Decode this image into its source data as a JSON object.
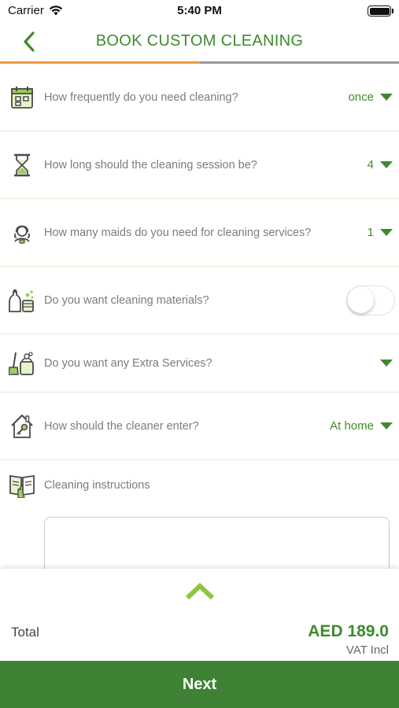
{
  "status_bar": {
    "carrier": "Carrier",
    "time": "5:40 PM"
  },
  "header": {
    "title": "BOOK CUSTOM CLEANING",
    "progress_fraction": 0.5
  },
  "questions": [
    {
      "icon": "calendar-icon",
      "text": "How frequently do you need cleaning?",
      "value": "once"
    },
    {
      "icon": "hourglass-icon",
      "text": "How long should the cleaning session be?",
      "value": "4"
    },
    {
      "icon": "maid-icon",
      "text": "How many maids do you need for cleaning services?",
      "value": "1"
    },
    {
      "icon": "cleaning-materials-icon",
      "text": "Do you want cleaning materials?",
      "toggle": false
    },
    {
      "icon": "extra-services-icon",
      "text": "Do you want any Extra Services?",
      "value": ""
    },
    {
      "icon": "house-key-icon",
      "text": "How should the cleaner enter?",
      "value": "At home"
    }
  ],
  "instructions": {
    "label": "Cleaning instructions",
    "value": ""
  },
  "summary": {
    "total_label": "Total",
    "amount": "AED 189.0",
    "vat": "VAT Incl"
  },
  "next_label": "Next",
  "colors": {
    "brand_green": "#3f8a2e",
    "button_green": "#3f8236",
    "progress_orange": "#ef9a45",
    "expand_arrow": "#8dc63f"
  }
}
